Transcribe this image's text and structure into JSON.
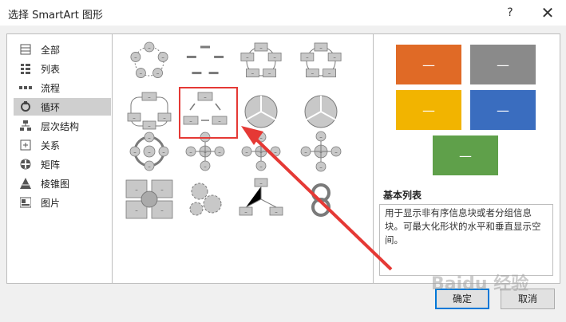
{
  "window": {
    "title": "选择 SmartArt 图形",
    "help_label": "?",
    "close_label": "✕"
  },
  "categories": [
    {
      "label": "全部",
      "icon": "all-icon"
    },
    {
      "label": "列表",
      "icon": "list-icon"
    },
    {
      "label": "流程",
      "icon": "process-icon"
    },
    {
      "label": "循环",
      "icon": "cycle-icon",
      "selected": true
    },
    {
      "label": "层次结构",
      "icon": "hierarchy-icon"
    },
    {
      "label": "关系",
      "icon": "relationship-icon"
    },
    {
      "label": "矩阵",
      "icon": "matrix-icon"
    },
    {
      "label": "棱锥图",
      "icon": "pyramid-icon"
    },
    {
      "label": "图片",
      "icon": "picture-icon"
    }
  ],
  "gallery": {
    "selected_index": 5,
    "thumb_dash": "–"
  },
  "preview": {
    "tile_label": "—",
    "tile_colors": [
      "#e06a26",
      "#8a8a8a",
      "#f2b400",
      "#3a6dbf",
      "#5fa04a"
    ],
    "name": "基本列表",
    "description": "用于显示非有序信息块或者分组信息块。可最大化形状的水平和垂直显示空间。"
  },
  "buttons": {
    "ok": "确定",
    "cancel": "取消"
  },
  "watermark": "Baidu 经验"
}
